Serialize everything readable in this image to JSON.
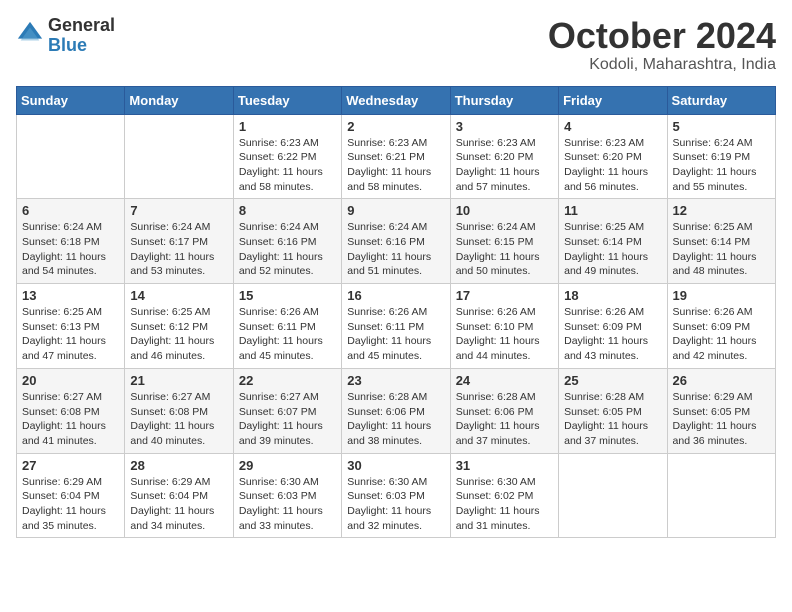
{
  "logo": {
    "general": "General",
    "blue": "Blue"
  },
  "title": "October 2024",
  "location": "Kodoli, Maharashtra, India",
  "days_header": [
    "Sunday",
    "Monday",
    "Tuesday",
    "Wednesday",
    "Thursday",
    "Friday",
    "Saturday"
  ],
  "weeks": [
    [
      {
        "day": "",
        "info": ""
      },
      {
        "day": "",
        "info": ""
      },
      {
        "day": "1",
        "info": "Sunrise: 6:23 AM\nSunset: 6:22 PM\nDaylight: 11 hours and 58 minutes."
      },
      {
        "day": "2",
        "info": "Sunrise: 6:23 AM\nSunset: 6:21 PM\nDaylight: 11 hours and 58 minutes."
      },
      {
        "day": "3",
        "info": "Sunrise: 6:23 AM\nSunset: 6:20 PM\nDaylight: 11 hours and 57 minutes."
      },
      {
        "day": "4",
        "info": "Sunrise: 6:23 AM\nSunset: 6:20 PM\nDaylight: 11 hours and 56 minutes."
      },
      {
        "day": "5",
        "info": "Sunrise: 6:24 AM\nSunset: 6:19 PM\nDaylight: 11 hours and 55 minutes."
      }
    ],
    [
      {
        "day": "6",
        "info": "Sunrise: 6:24 AM\nSunset: 6:18 PM\nDaylight: 11 hours and 54 minutes."
      },
      {
        "day": "7",
        "info": "Sunrise: 6:24 AM\nSunset: 6:17 PM\nDaylight: 11 hours and 53 minutes."
      },
      {
        "day": "8",
        "info": "Sunrise: 6:24 AM\nSunset: 6:16 PM\nDaylight: 11 hours and 52 minutes."
      },
      {
        "day": "9",
        "info": "Sunrise: 6:24 AM\nSunset: 6:16 PM\nDaylight: 11 hours and 51 minutes."
      },
      {
        "day": "10",
        "info": "Sunrise: 6:24 AM\nSunset: 6:15 PM\nDaylight: 11 hours and 50 minutes."
      },
      {
        "day": "11",
        "info": "Sunrise: 6:25 AM\nSunset: 6:14 PM\nDaylight: 11 hours and 49 minutes."
      },
      {
        "day": "12",
        "info": "Sunrise: 6:25 AM\nSunset: 6:14 PM\nDaylight: 11 hours and 48 minutes."
      }
    ],
    [
      {
        "day": "13",
        "info": "Sunrise: 6:25 AM\nSunset: 6:13 PM\nDaylight: 11 hours and 47 minutes."
      },
      {
        "day": "14",
        "info": "Sunrise: 6:25 AM\nSunset: 6:12 PM\nDaylight: 11 hours and 46 minutes."
      },
      {
        "day": "15",
        "info": "Sunrise: 6:26 AM\nSunset: 6:11 PM\nDaylight: 11 hours and 45 minutes."
      },
      {
        "day": "16",
        "info": "Sunrise: 6:26 AM\nSunset: 6:11 PM\nDaylight: 11 hours and 45 minutes."
      },
      {
        "day": "17",
        "info": "Sunrise: 6:26 AM\nSunset: 6:10 PM\nDaylight: 11 hours and 44 minutes."
      },
      {
        "day": "18",
        "info": "Sunrise: 6:26 AM\nSunset: 6:09 PM\nDaylight: 11 hours and 43 minutes."
      },
      {
        "day": "19",
        "info": "Sunrise: 6:26 AM\nSunset: 6:09 PM\nDaylight: 11 hours and 42 minutes."
      }
    ],
    [
      {
        "day": "20",
        "info": "Sunrise: 6:27 AM\nSunset: 6:08 PM\nDaylight: 11 hours and 41 minutes."
      },
      {
        "day": "21",
        "info": "Sunrise: 6:27 AM\nSunset: 6:08 PM\nDaylight: 11 hours and 40 minutes."
      },
      {
        "day": "22",
        "info": "Sunrise: 6:27 AM\nSunset: 6:07 PM\nDaylight: 11 hours and 39 minutes."
      },
      {
        "day": "23",
        "info": "Sunrise: 6:28 AM\nSunset: 6:06 PM\nDaylight: 11 hours and 38 minutes."
      },
      {
        "day": "24",
        "info": "Sunrise: 6:28 AM\nSunset: 6:06 PM\nDaylight: 11 hours and 37 minutes."
      },
      {
        "day": "25",
        "info": "Sunrise: 6:28 AM\nSunset: 6:05 PM\nDaylight: 11 hours and 37 minutes."
      },
      {
        "day": "26",
        "info": "Sunrise: 6:29 AM\nSunset: 6:05 PM\nDaylight: 11 hours and 36 minutes."
      }
    ],
    [
      {
        "day": "27",
        "info": "Sunrise: 6:29 AM\nSunset: 6:04 PM\nDaylight: 11 hours and 35 minutes."
      },
      {
        "day": "28",
        "info": "Sunrise: 6:29 AM\nSunset: 6:04 PM\nDaylight: 11 hours and 34 minutes."
      },
      {
        "day": "29",
        "info": "Sunrise: 6:30 AM\nSunset: 6:03 PM\nDaylight: 11 hours and 33 minutes."
      },
      {
        "day": "30",
        "info": "Sunrise: 6:30 AM\nSunset: 6:03 PM\nDaylight: 11 hours and 32 minutes."
      },
      {
        "day": "31",
        "info": "Sunrise: 6:30 AM\nSunset: 6:02 PM\nDaylight: 11 hours and 31 minutes."
      },
      {
        "day": "",
        "info": ""
      },
      {
        "day": "",
        "info": ""
      }
    ]
  ]
}
